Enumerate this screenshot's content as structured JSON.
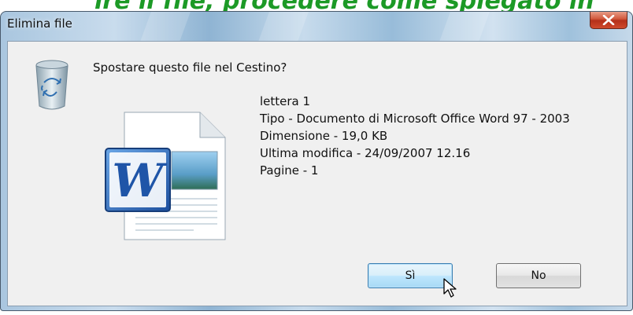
{
  "banner": {
    "text": "ire il file, procedere come spiegato in questa pagina"
  },
  "window": {
    "title": "Elimina file"
  },
  "dialog": {
    "question": "Spostare questo file nel Cestino?",
    "file": {
      "name": "lettera 1",
      "type": "Tipo - Documento di Microsoft Office Word 97 - 2003",
      "size": "Dimensione - 19,0 KB",
      "modified": "Ultima modifica - 24/09/2007 12.16",
      "pages": "Pagine - 1"
    },
    "buttons": {
      "yes": "Sì",
      "no": "No"
    }
  },
  "icons": {
    "close": "close-icon",
    "recycle": "recycle-bin-icon",
    "document": "word-document-icon",
    "cursor": "mouse-pointer-icon"
  },
  "colors": {
    "banner_text": "#1c9a26",
    "close_button": "#c9432b",
    "primary_button_border": "#3c7fb1"
  }
}
